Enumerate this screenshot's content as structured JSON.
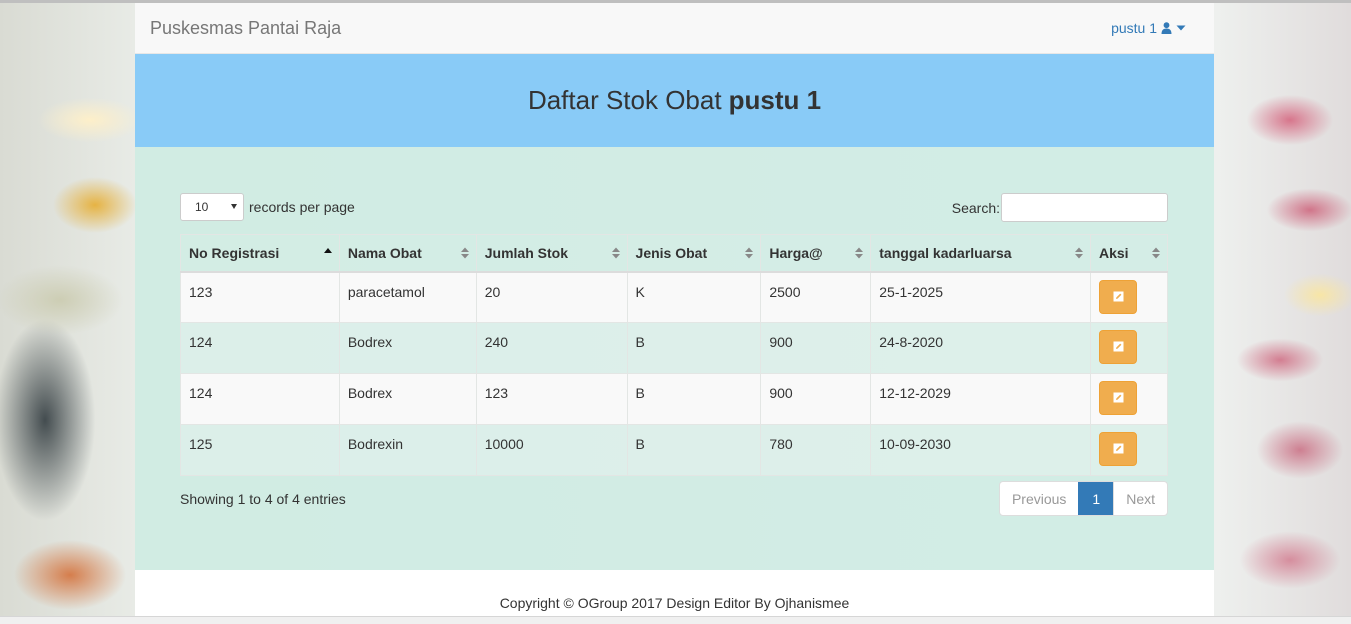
{
  "navbar": {
    "brand": "Puskesmas Pantai Raja",
    "user": "pustu 1"
  },
  "header": {
    "title_prefix": "Daftar Stok Obat",
    "title_bold": "pustu 1"
  },
  "table_controls": {
    "length_value": "10",
    "length_label": "records per page",
    "search_label": "Search:",
    "search_value": ""
  },
  "table": {
    "columns": [
      "No Registrasi",
      "Nama Obat",
      "Jumlah Stok",
      "Jenis Obat",
      "Harga@",
      "tanggal kadarluarsa",
      "Aksi"
    ],
    "rows": [
      [
        "123",
        "paracetamol",
        "20",
        "K",
        "2500",
        "25-1-2025"
      ],
      [
        "124",
        "Bodrex",
        "240",
        "B",
        "900",
        "24-8-2020"
      ],
      [
        "124",
        "Bodrex",
        "123",
        "B",
        "900",
        "12-12-2029"
      ],
      [
        "125",
        "Bodrexin",
        "10000",
        "B",
        "780",
        "10-09-2030"
      ]
    ]
  },
  "pagination": {
    "info": "Showing 1 to 4 of 4 entries",
    "previous": "Previous",
    "current": "1",
    "next": "Next"
  },
  "footer": {
    "text": "Copyright © OGroup 2017 Design Editor By Ojhanismee"
  },
  "colors": {
    "header_band": "#89cbf7",
    "edit_button": "#f0ad4e",
    "link": "#337ab7"
  }
}
